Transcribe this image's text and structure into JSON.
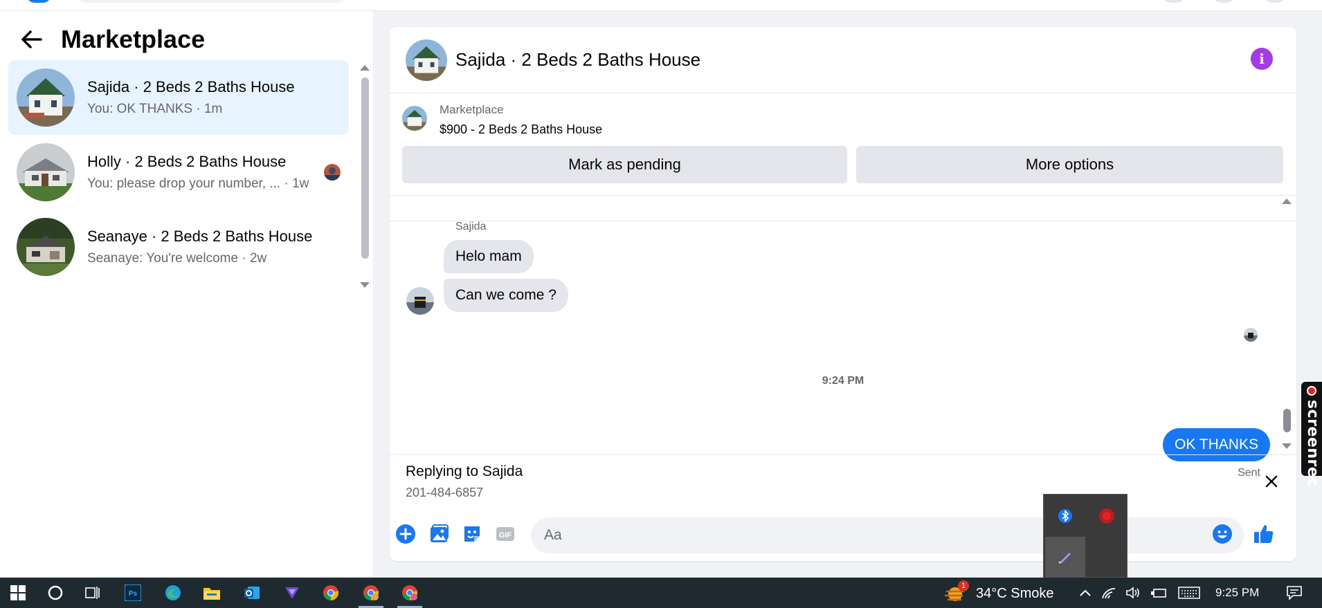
{
  "left_panel": {
    "title": "Marketplace",
    "conversations": [
      {
        "name": "Sajida · 2 Beds 2 Baths House",
        "preview": "You: OK THANKS · 1m",
        "active": true
      },
      {
        "name": "Holly · 2 Beds 2 Baths House",
        "preview": "You: please drop your number, ...  · 1w",
        "active": false
      },
      {
        "name": "Seanaye · 2 Beds 2 Baths House",
        "preview": "Seanaye: You're welcome · 2w",
        "active": false
      }
    ]
  },
  "chat": {
    "title": "Sajida · 2 Beds 2 Baths House",
    "marketplace_label": "Marketplace",
    "listing": "$900 - 2 Beds 2 Baths House",
    "mark_pending_label": "Mark as pending",
    "more_options_label": "More options",
    "sender_name": "Sajida",
    "incoming": [
      "Helo mam",
      "Can we come ?"
    ],
    "timestamp": "9:24 PM",
    "outgoing": "OK THANKS",
    "sent_status": "Sent",
    "reply_title": "Replying to Sajida",
    "reply_text": "201-484-6857",
    "input_placeholder": "Aa"
  },
  "side_tab": {
    "label": "screenrec"
  },
  "taskbar": {
    "weather": "34°C  Smoke",
    "notification_count": "1",
    "time": "9:25 PM"
  },
  "colors": {
    "accent": "#1877f2",
    "info": "#a33be6",
    "active_row": "#e7f3ff",
    "taskbar": "#1f2a30"
  },
  "icons": [
    "back-arrow-icon",
    "info-icon",
    "close-icon",
    "add-icon",
    "image-icon",
    "sticker-icon",
    "gif-icon",
    "emoji-icon",
    "like-icon",
    "bluetooth-icon",
    "record-icon",
    "pen-icon",
    "windows-icon",
    "cortana-icon",
    "task-view-icon",
    "photoshop-icon",
    "edge-icon",
    "file-explorer-icon",
    "outlook-icon",
    "vpn-icon",
    "chrome-icon",
    "weather-icon",
    "chevron-up-icon",
    "wifi-icon",
    "volume-icon",
    "battery-icon",
    "keyboard-icon",
    "notification-icon"
  ]
}
